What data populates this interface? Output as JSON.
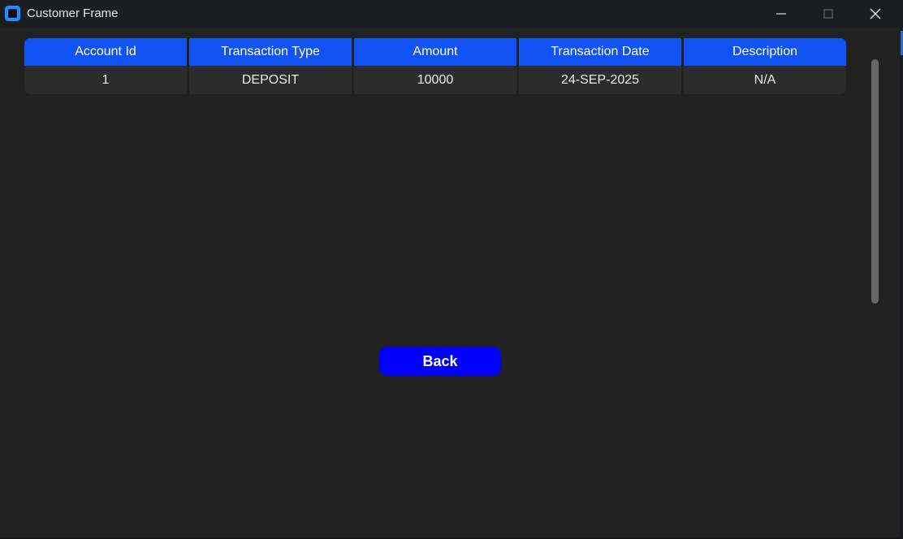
{
  "window": {
    "title": "Customer Frame",
    "app_icon": "app-square-icon",
    "controls": {
      "minimize_icon": "minimize-icon",
      "maximize_icon": "maximize-icon",
      "close_icon": "close-icon"
    }
  },
  "table": {
    "headers": [
      "Account Id",
      "Transaction Type",
      "Amount",
      "Transaction Date",
      "Description"
    ],
    "rows": [
      [
        "1",
        "DEPOSIT",
        "10000",
        "24-SEP-2025",
        "N/A"
      ]
    ]
  },
  "back_button": {
    "label": "Back"
  },
  "colors": {
    "header_bg": "#1152f3",
    "row_bg": "#2c2c2d",
    "button_bg": "#0000ff",
    "window_bg": "#212122"
  }
}
